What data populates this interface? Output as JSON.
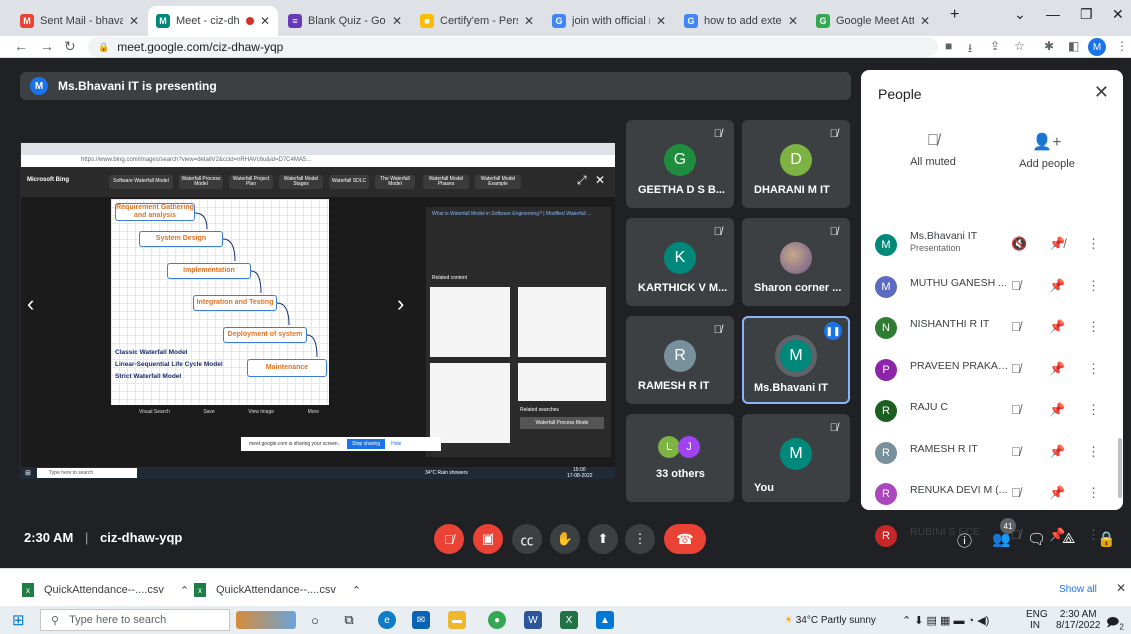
{
  "browser": {
    "tabs": [
      {
        "title": "Sent Mail - bhavani@",
        "fav": "M",
        "color": "#ea4335"
      },
      {
        "title": "Meet - ciz-dhaw",
        "fav": "M",
        "color": "#00897b",
        "active": true
      },
      {
        "title": "Blank Quiz - Google F",
        "fav": "≡",
        "color": "#673ab7"
      },
      {
        "title": "Certify'em - Personal",
        "fav": "■",
        "color": "#fbbc04"
      },
      {
        "title": "join with official mail",
        "fav": "G",
        "color": "#4285f4"
      },
      {
        "title": "how to add extension",
        "fav": "G",
        "color": "#4285f4"
      },
      {
        "title": "Google Meet Attenda",
        "fav": "G",
        "color": "#34a853"
      }
    ],
    "new_tab": "+",
    "url": "meet.google.com/ciz-dhaw-yqp",
    "profile": "M"
  },
  "meet": {
    "presenting": "Ms.Bhavani IT is presenting",
    "presenter_initial": "M",
    "shared": {
      "address": "https://www.bing.com/images/search?view=detailV2&ccid=nRHAVc6u&id=D7C4MA5...",
      "bing_label": "Microsoft Bing",
      "chips": [
        "Software Waterfall Model",
        "Waterfall Process Model",
        "Waterfall Project Plan",
        "Waterfall Model Stages",
        "Waterfall SDLC",
        "The Waterfall Model",
        "Waterfall Model Phases",
        "Waterfall Model Example"
      ],
      "steps": [
        "Requirement Gathering and analysis",
        "System Design",
        "Implementation",
        "Integration and Testing",
        "Deployment of system",
        "Maintenance"
      ],
      "models": [
        "Classic Waterfall Model",
        "Linear-Sequential Life Cycle Model",
        "Strict Waterfall Model"
      ],
      "right_title": "What is Waterfall Model in Software Engineering? | Modified Waterfall ...",
      "related": "Related content",
      "related_searches": "Related searches",
      "process_mode": "Waterfall Process Mode",
      "share_msg": "meet.google.com is sharing your screen.",
      "stop": "Stop sharing",
      "hide": "Hide",
      "footer": [
        "Visual Search",
        "Save",
        "View image",
        "More"
      ],
      "taskbar_search": "Type here to search",
      "weather": "34°C Rain showers",
      "time": "15:00",
      "date": "17-08-2022"
    },
    "tiles": [
      {
        "name": "GEETHA D S B...",
        "initial": "G",
        "color": "#1e8e3e",
        "muted": true
      },
      {
        "name": "DHARANI M IT",
        "initial": "D",
        "color": "#7cb342",
        "muted": true
      },
      {
        "name": "KARTHICK V M...",
        "initial": "K",
        "color": "#00897b",
        "muted": true
      },
      {
        "name": "Sharon corner ...",
        "initial": "",
        "color": "#8e6fb5",
        "muted": true
      },
      {
        "name": "RAMESH R IT",
        "initial": "R",
        "color": "#78909c",
        "muted": true
      },
      {
        "name": "Ms.Bhavani IT",
        "initial": "M",
        "color": "#00897b",
        "muted": false
      },
      {
        "name": "33 others",
        "initial": "L",
        "color": "#7cb342",
        "muted": false
      },
      {
        "name": "You",
        "initial": "M",
        "color": "#00897b",
        "muted": true
      }
    ],
    "others_second": "J",
    "others_second_color": "#a142f4",
    "clock": "2:30 AM",
    "meeting_code": "ciz-dhaw-yqp",
    "people_count": "41"
  },
  "people": {
    "title": "People",
    "all_muted": "All muted",
    "add_people": "Add people",
    "list": [
      {
        "name": "Ms.Bhavani IT",
        "sub": "Presentation",
        "initial": "M",
        "color": "#00897b"
      },
      {
        "name": "MUTHU GANESH ...",
        "sub": "",
        "initial": "M",
        "color": "#5c6bc0"
      },
      {
        "name": "NISHANTHI R IT",
        "sub": "",
        "initial": "N",
        "color": "#2e7d32"
      },
      {
        "name": "PRAVEEN PRAKAS...",
        "sub": "",
        "initial": "P",
        "color": "#8e24aa"
      },
      {
        "name": "RAJU C",
        "sub": "",
        "initial": "R",
        "color": "#1b5e20"
      },
      {
        "name": "RAMESH R IT",
        "sub": "",
        "initial": "R",
        "color": "#78909c"
      },
      {
        "name": "RENUKA DEVI M (...",
        "sub": "",
        "initial": "R",
        "color": "#ab47bc"
      },
      {
        "name": "RUBINI S ECE",
        "sub": "",
        "initial": "R",
        "color": "#c62828"
      }
    ]
  },
  "downloads": {
    "items": [
      "QuickAttendance--....csv",
      "QuickAttendance--....csv"
    ],
    "show_all": "Show all"
  },
  "taskbar": {
    "search": "Type here to search",
    "weather": "34°C  Partly sunny",
    "lang1": "ENG",
    "lang2": "IN",
    "time": "2:30 AM",
    "date": "8/17/2022",
    "notif": "2"
  }
}
